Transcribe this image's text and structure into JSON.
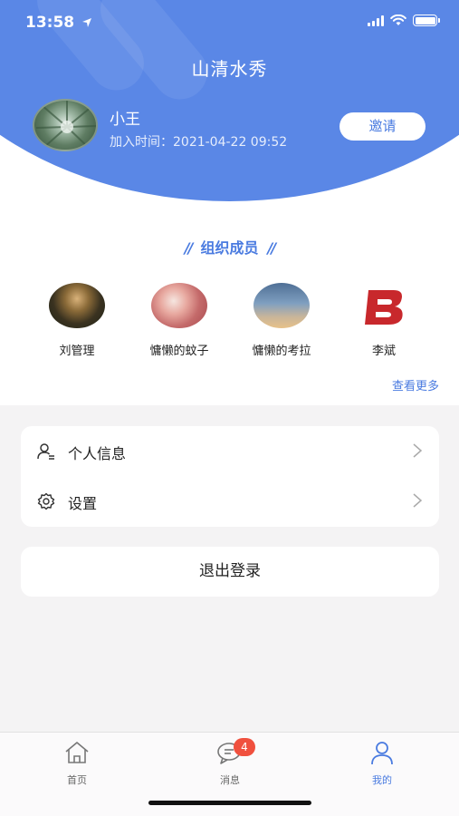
{
  "status": {
    "time": "13:58"
  },
  "header": {
    "title": "山清水秀"
  },
  "profile": {
    "name": "小王",
    "join_time": "加入时间：2021-04-22 09:52",
    "invite_label": "邀请"
  },
  "members_section": {
    "title": "组织成员",
    "see_more": "查看更多",
    "members": [
      {
        "name": "刘管理"
      },
      {
        "name": "慵懒的蚊子"
      },
      {
        "name": "慵懒的考拉"
      },
      {
        "name": "李斌"
      }
    ]
  },
  "menu": {
    "items": [
      {
        "label": "个人信息",
        "icon": "user-info-icon"
      },
      {
        "label": "设置",
        "icon": "gear-icon"
      }
    ],
    "logout_label": "退出登录"
  },
  "tabbar": {
    "tabs": [
      {
        "label": "首页",
        "icon": "home-icon"
      },
      {
        "label": "消息",
        "icon": "message-icon",
        "badge": "4"
      },
      {
        "label": "我的",
        "icon": "profile-icon",
        "active": true
      }
    ]
  },
  "colors": {
    "accent": "#4a7be0",
    "header_blue": "#5a87e6",
    "badge_red": "#f0503e"
  }
}
